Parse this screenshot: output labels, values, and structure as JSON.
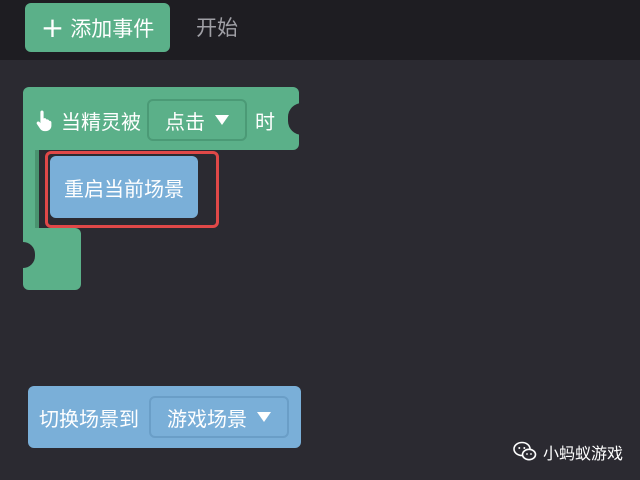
{
  "toolbar": {
    "add_event_label": "添加事件",
    "start_tab_label": "开始"
  },
  "event_block": {
    "prefix": "当精灵被",
    "trigger_value": "点击",
    "suffix": "时"
  },
  "action_block": {
    "label": "重启当前场景"
  },
  "switch_block": {
    "label": "切换场景到",
    "scene_value": "游戏场景"
  },
  "watermark": {
    "text": "小蚂蚁游戏"
  },
  "colors": {
    "event_green": "#5bb089",
    "action_blue": "#7aafd8",
    "highlight_red": "#e04848",
    "background": "#2b2a31"
  }
}
